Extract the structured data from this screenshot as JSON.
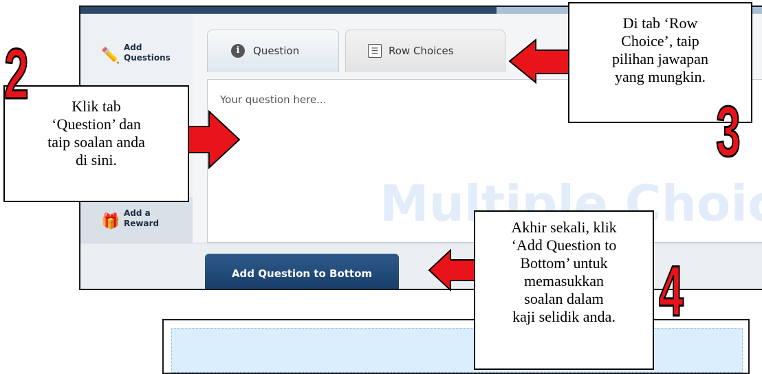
{
  "sidebar": {
    "items": [
      {
        "icon": "pencil-icon",
        "label": "Add Questions"
      },
      {
        "icon": "gift-icon",
        "label": "Add a Reward"
      }
    ]
  },
  "tabs": [
    {
      "icon": "info-icon",
      "glyph": "i",
      "label": "Question"
    },
    {
      "icon": "list-icon",
      "glyph": "☰",
      "label": "Row Choices"
    }
  ],
  "question_panel": {
    "placeholder": "Your question here...",
    "watermark": "Multiple Choice"
  },
  "bottom": {
    "add_button_label": "Add Question to Bottom"
  },
  "callouts": {
    "step2": {
      "number": "2",
      "lines": [
        "Klik tab",
        "‘Question’ dan",
        "taip soalan anda",
        "di sini."
      ]
    },
    "step3": {
      "number": "3",
      "lines": [
        "Di tab ‘Row",
        "Choice’, taip",
        "pilihan jawapan",
        "yang mungkin."
      ]
    },
    "step4": {
      "number": "4",
      "lines": [
        "Akhir sekali, klik",
        "‘Add Question to",
        "Bottom’ untuk",
        "memasukkan",
        "soalan dalam",
        "kaji selidik anda."
      ]
    }
  },
  "colors": {
    "arrow_fill": "#e8141a",
    "button_bg": "#1f4773",
    "watermark": "#e3edf9"
  }
}
